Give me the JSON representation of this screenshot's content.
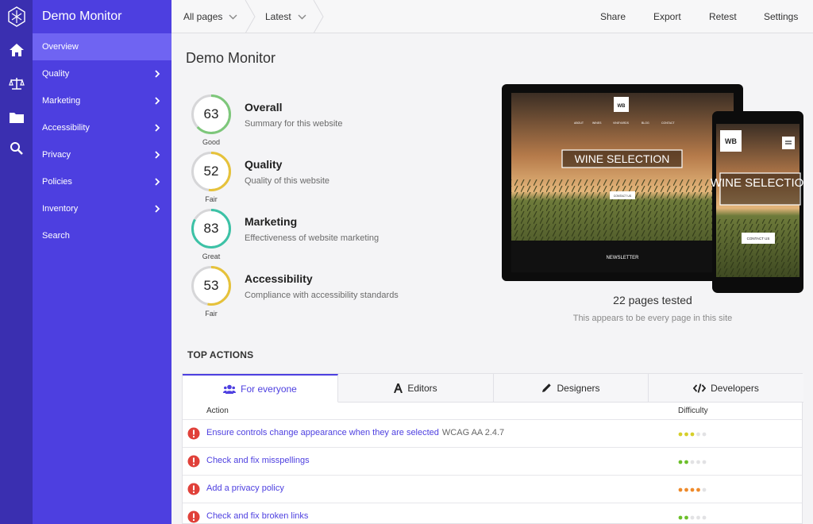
{
  "sidebar": {
    "title": "Demo Monitor",
    "items": [
      {
        "label": "Overview"
      },
      {
        "label": "Quality"
      },
      {
        "label": "Marketing"
      },
      {
        "label": "Accessibility"
      },
      {
        "label": "Privacy"
      },
      {
        "label": "Policies"
      },
      {
        "label": "Inventory"
      },
      {
        "label": "Search"
      }
    ]
  },
  "topbar": {
    "pages_filter": "All pages",
    "version_filter": "Latest",
    "actions": [
      "Share",
      "Export",
      "Retest",
      "Settings"
    ]
  },
  "page": {
    "title": "Demo Monitor"
  },
  "scores": [
    {
      "value": 63,
      "rating": "Good",
      "title": "Overall",
      "subtitle": "Summary for this website"
    },
    {
      "value": 52,
      "rating": "Fair",
      "title": "Quality",
      "subtitle": "Quality of this website"
    },
    {
      "value": 83,
      "rating": "Great",
      "title": "Marketing",
      "subtitle": "Effectiveness of website marketing"
    },
    {
      "value": 53,
      "rating": "Fair",
      "title": "Accessibility",
      "subtitle": "Compliance with accessibility standards"
    }
  ],
  "preview": {
    "logo": "WB",
    "hero_title": "WINE SELECTION",
    "menu": [
      "ABOUT",
      "WINES",
      "VINEYARDS",
      "BLOG",
      "CONTACT"
    ],
    "cta": "CONTACT US",
    "newsletter": "NEWSLETTER",
    "pages_tested": "22 pages tested",
    "pages_note": "This appears to be every page in this site"
  },
  "top_actions": {
    "heading": "TOP ACTIONS",
    "tabs": [
      {
        "label": "For everyone",
        "icon": "users-icon"
      },
      {
        "label": "Editors",
        "icon": "font-icon"
      },
      {
        "label": "Designers",
        "icon": "pencil-icon"
      },
      {
        "label": "Developers",
        "icon": "code-icon"
      }
    ],
    "columns": {
      "action": "Action",
      "difficulty": "Difficulty"
    },
    "rows": [
      {
        "action": "Ensure controls change appearance when they are selected",
        "tag": "WCAG AA 2.4.7",
        "difficulty": 3,
        "color": "#d6cf2a"
      },
      {
        "action": "Check and fix misspellings",
        "tag": "",
        "difficulty": 2,
        "color": "#6cbf2a"
      },
      {
        "action": "Add a privacy policy",
        "tag": "",
        "difficulty": 4,
        "color": "#ee8a2b"
      },
      {
        "action": "Check and fix broken links",
        "tag": "",
        "difficulty": 2,
        "color": "#6cbf2a"
      }
    ]
  },
  "colors": {
    "accent": "#4d3fe0",
    "rail": "#3a2fb0",
    "error": "#e0413a",
    "good": "#7dc77a",
    "fair": "#e6c23a",
    "great": "#3cc2a6"
  }
}
